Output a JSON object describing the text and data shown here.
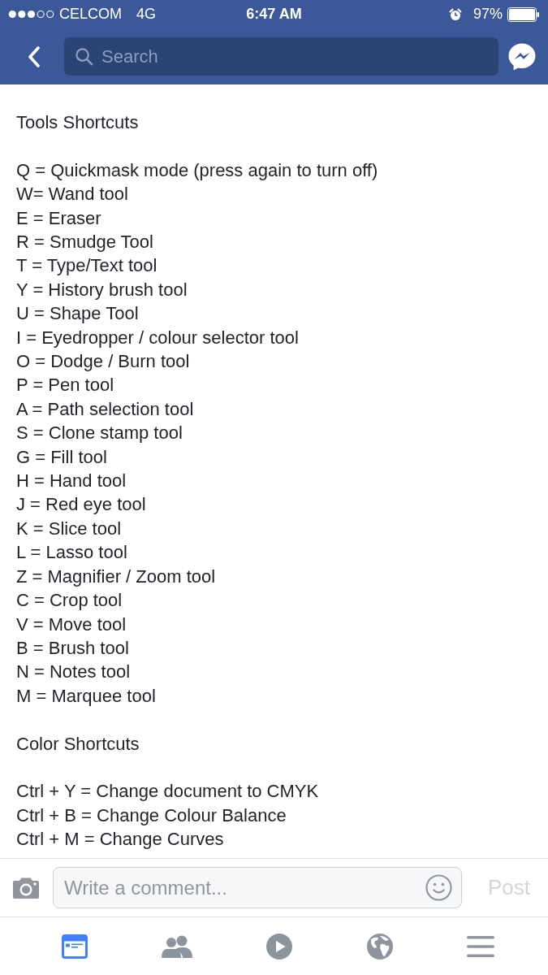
{
  "status_bar": {
    "carrier": "CELCOM",
    "network": "4G",
    "time": "6:47 AM",
    "battery": "97%"
  },
  "nav_bar": {
    "search": {
      "placeholder": "Search"
    }
  },
  "post": {
    "sections": [
      {
        "heading": "Tools Shortcuts",
        "lines": [
          "Q = Quickmask mode (press again to turn off)",
          "W= Wand tool",
          "E = Eraser",
          "R = Smudge Tool",
          "T = Type/Text tool",
          "Y = History brush tool",
          "U = Shape Tool",
          "I = Eyedropper / colour selector tool",
          "O = Dodge / Burn tool",
          "P = Pen tool",
          "A = Path selection tool",
          "S = Clone stamp tool",
          "G = Fill tool",
          "H = Hand tool",
          "J = Red eye tool",
          "K = Slice tool",
          "L = Lasso tool",
          "Z = Magnifier / Zoom tool",
          "C = Crop tool",
          "V = Move tool",
          "B = Brush tool",
          "N = Notes tool",
          "M = Marquee tool"
        ]
      },
      {
        "heading": "Color Shortcuts",
        "lines": [
          "Ctrl + Y = Change document to CMYK",
          "Ctrl + B = Change Colour Balance",
          "Ctrl + M = Change Curves"
        ]
      }
    ]
  },
  "comment_bar": {
    "input": {
      "placeholder": "Write a comment..."
    },
    "post_button": {
      "label": "Post",
      "disabled": true
    }
  },
  "tab_bar": [
    {
      "kind": "feed",
      "selected": true
    },
    {
      "kind": "friends",
      "selected": false
    },
    {
      "kind": "video",
      "selected": false
    },
    {
      "kind": "globe",
      "selected": false
    },
    {
      "kind": "menu",
      "selected": false
    }
  ]
}
